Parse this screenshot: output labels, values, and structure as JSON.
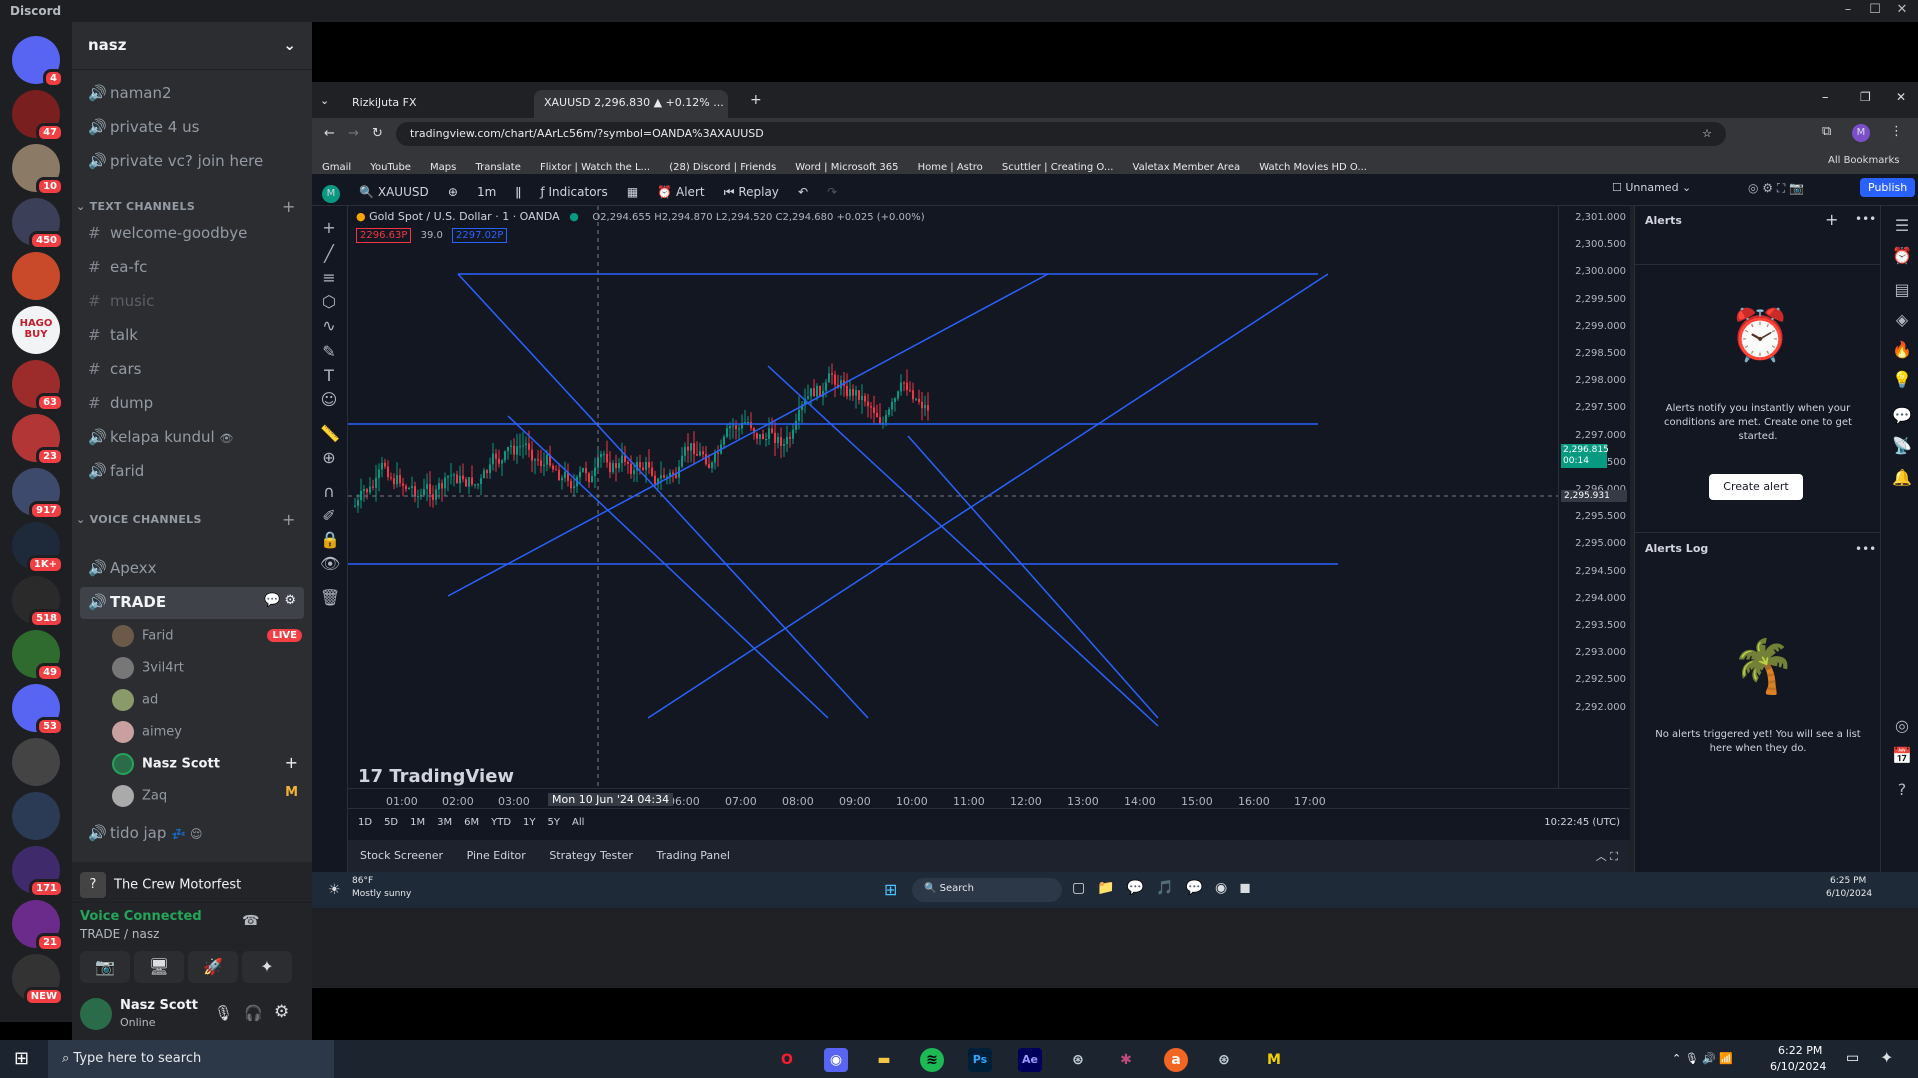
{
  "app": {
    "title": "Discord"
  },
  "servers": [
    {
      "name": "discord-home",
      "badge": "4",
      "color": "#5865f2"
    },
    {
      "name": "server-2",
      "badge": "47",
      "color": "#7a1f1f"
    },
    {
      "name": "server-3",
      "badge": "10",
      "color": "#8a7a66"
    },
    {
      "name": "server-4",
      "badge": "450",
      "color": "#3b3f58"
    },
    {
      "name": "server-5",
      "badge": "",
      "color": "#c84a2a"
    },
    {
      "name": "hago-buy",
      "badge": "",
      "color": "#f2f3f5",
      "text": "HAGO BUY"
    },
    {
      "name": "server-7",
      "badge": "63",
      "color": "#9c2b2b"
    },
    {
      "name": "server-8",
      "badge": "23",
      "color": "#b33636"
    },
    {
      "name": "server-9",
      "badge": "917",
      "color": "#3d4a6b"
    },
    {
      "name": "server-10",
      "badge": "1K+",
      "color": "#1e2a3a"
    },
    {
      "name": "server-11",
      "badge": "518",
      "color": "#2a2a2a"
    },
    {
      "name": "server-12",
      "badge": "49",
      "color": "#2f6b2f"
    },
    {
      "name": "server-13",
      "badge": "53",
      "color": "#5865f2"
    },
    {
      "name": "server-14",
      "badge": "",
      "color": "#444"
    },
    {
      "name": "server-15",
      "badge": "",
      "color": "#2b3a55"
    },
    {
      "name": "server-16",
      "badge": "171",
      "color": "#3f2b6b"
    },
    {
      "name": "server-17",
      "badge": "21",
      "color": "#6b2b8a"
    },
    {
      "name": "server-18",
      "badge": "NEW",
      "color": "#333"
    }
  ],
  "channel_list": {
    "server_name": "nasz",
    "top_channels": [
      "naman2",
      "private 4 us",
      "private vc? join here"
    ],
    "text_category": "TEXT CHANNELS",
    "text_channels": [
      "welcome-goodbye",
      "ea-fc",
      "music",
      "talk",
      "cars",
      "dump",
      "kelapa kundul",
      "farid"
    ],
    "voice_category": "VOICE CHANNELS",
    "voice_channels": [
      "Apexx",
      "TRADE"
    ],
    "trade_users": [
      "Farid",
      "3vil4rt",
      "ad",
      "aimey",
      "Nasz Scott",
      "Zaq"
    ],
    "live_label": "LIVE",
    "after_channel": "tido jap",
    "activity": "The Crew Motorfest"
  },
  "voice_panel": {
    "status": "Voice Connected",
    "location": "TRADE / nasz"
  },
  "user_panel": {
    "name": "Nasz Scott",
    "status": "Online"
  },
  "browser": {
    "tabs": [
      "RizkiJuta FX",
      "XAUUSD 2,296.830 ▲ +0.12% ..."
    ],
    "url": "tradingview.com/chart/AArLc56m/?symbol=OANDA%3AXAUUSD",
    "bookmarks": [
      "Gmail",
      "YouTube",
      "Maps",
      "Translate",
      "Flixtor | Watch the L...",
      "(28) Discord | Friends",
      "Word | Microsoft 365",
      "Home | Astro",
      "Scuttler | Creating O...",
      "Valetax Member Area",
      "Watch Movies HD O..."
    ],
    "all_bookmarks": "All Bookmarks"
  },
  "tradingview": {
    "symbol": "XAUUSD",
    "interval": "1m",
    "toolbar": [
      "Indicators",
      "Alert",
      "Replay"
    ],
    "layout_name": "Unnamed",
    "publish": "Publish",
    "legend_title": "Gold Spot / U.S. Dollar · 1 · OANDA",
    "ohlc": "O2,294.655 H2,294.870 L2,294.520 C2,294.680 +0.025 (+0.00%)",
    "bid": "2296.63P",
    "spread": "39.0",
    "ask": "2297.02P",
    "watermark": "TradingView",
    "price_labels": [
      "2,301.000",
      "2,300.500",
      "2,300.000",
      "2,299.500",
      "2,299.000",
      "2,298.500",
      "2,298.000",
      "2,297.500",
      "2,297.000",
      "2,296.500",
      "2,296.000",
      "2,295.500",
      "2,295.000",
      "2,294.500",
      "2,294.000",
      "2,293.500",
      "2,293.000",
      "2,292.500",
      "2,292.000"
    ],
    "current_price": "2,296.815",
    "countdown": "00:14",
    "crosshair_price": "2,295.931",
    "time_labels": [
      "01:00",
      "02:00",
      "03:00",
      "06:00",
      "07:00",
      "08:00",
      "09:00",
      "10:00",
      "11:00",
      "12:00",
      "13:00",
      "14:00",
      "15:00",
      "16:00",
      "17:00"
    ],
    "crosshair_time": "Mon 10 Jun '24   04:34",
    "ranges": [
      "1D",
      "5D",
      "1M",
      "3M",
      "6M",
      "YTD",
      "1Y",
      "5Y",
      "All"
    ],
    "clock": "10:22:45 (UTC)",
    "bottom_tabs": [
      "Stock Screener",
      "Pine Editor",
      "Strategy Tester",
      "Trading Panel"
    ],
    "alerts_title": "Alerts",
    "alerts_msg": "Alerts notify you instantly when your conditions are met. Create one to get started.",
    "create_alert": "Create alert",
    "alerts_log": "Alerts Log",
    "log_msg": "No alerts triggered yet! You will see a list here when they do."
  },
  "inner_taskbar": {
    "weather_temp": "86°F",
    "weather_desc": "Mostly sunny",
    "search": "Search",
    "time": "6:25 PM",
    "date": "6/10/2024"
  },
  "taskbar": {
    "search_placeholder": "Type here to search",
    "time": "6:22 PM",
    "date": "6/10/2024"
  },
  "colors": {
    "discord_bg": "#2b2d31",
    "chart_bg": "#131722",
    "trendline": "#2962ff",
    "up": "#089981",
    "down": "#f23645",
    "live": "#f23f43"
  }
}
